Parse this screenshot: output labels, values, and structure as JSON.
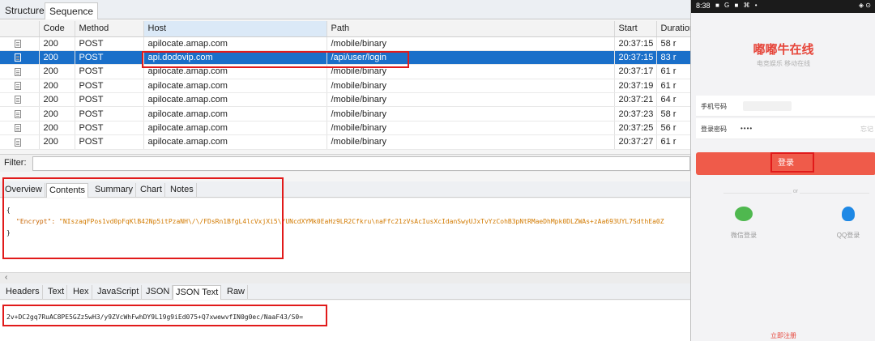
{
  "tool": {
    "top_tabs": [
      "Structure",
      "Sequence"
    ],
    "columns": [
      "",
      "Code",
      "Method",
      "Host",
      "Path",
      "Start",
      "Duration"
    ],
    "rows": [
      {
        "code": "200",
        "method": "POST",
        "host": "apilocate.amap.com",
        "path": "/mobile/binary",
        "start": "20:37:15",
        "duration": "58 r"
      },
      {
        "code": "200",
        "method": "POST",
        "host": "api.dodovip.com",
        "path": "/api/user/login",
        "start": "20:37:15",
        "duration": "83 r"
      },
      {
        "code": "200",
        "method": "POST",
        "host": "apilocate.amap.com",
        "path": "/mobile/binary",
        "start": "20:37:17",
        "duration": "61 r"
      },
      {
        "code": "200",
        "method": "POST",
        "host": "apilocate.amap.com",
        "path": "/mobile/binary",
        "start": "20:37:19",
        "duration": "61 r"
      },
      {
        "code": "200",
        "method": "POST",
        "host": "apilocate.amap.com",
        "path": "/mobile/binary",
        "start": "20:37:21",
        "duration": "64 r"
      },
      {
        "code": "200",
        "method": "POST",
        "host": "apilocate.amap.com",
        "path": "/mobile/binary",
        "start": "20:37:23",
        "duration": "58 r"
      },
      {
        "code": "200",
        "method": "POST",
        "host": "apilocate.amap.com",
        "path": "/mobile/binary",
        "start": "20:37:25",
        "duration": "56 r"
      },
      {
        "code": "200",
        "method": "POST",
        "host": "apilocate.amap.com",
        "path": "/mobile/binary",
        "start": "20:37:27",
        "duration": "61 r"
      }
    ],
    "filter_label": "Filter:",
    "request_tabs": [
      "Overview",
      "Contents",
      "Summary",
      "Chart",
      "Notes"
    ],
    "request_body": {
      "open": "{",
      "key": "\"Encrypt\"",
      "value": "\"NIszaqFPos1vd0pFqKlB42Np5itPzaNH\\/\\/FDsRn1BfgL4lcVxjXi5\\/UNcdXYMk0EaHz9LR2Cfkru\\naFfc21zVsAcIusXcIdanSwyUJxTvYzCohB3pNtRMaeDhMpk0DLZWAs+zAa693UYL7SdthEa0Z",
      "close": "}"
    },
    "response_tabs": [
      "Headers",
      "Text",
      "Hex",
      "JavaScript",
      "JSON",
      "JSON Text",
      "Raw"
    ],
    "response_text": "2v+DC2gq7RuAC8PE5GZz5wH3/y9ZVcWhFwhDY9L19g9iEd075+Q7xwewvfIN0g0ec/NaaF43/S0="
  },
  "phone": {
    "status": {
      "time": "8:38",
      "icons": "■ G ■ ⌘ •",
      "right": "◈ ⊙"
    },
    "app_title": "嘟嘟牛在线",
    "app_subtitle": "电竞娱乐 移动在线",
    "phone_label": "手机号码",
    "password_label": "登录密码",
    "password_value": "••••",
    "password_hint": "忘记",
    "login_button": "登录",
    "or_text": "or",
    "wechat_label": "微信登录",
    "qq_label": "QQ登录",
    "register_link": "立即注册",
    "colors": {
      "accent": "#ef5b4a",
      "wechat": "#4fb84f",
      "qq": "#1e88e5"
    }
  }
}
